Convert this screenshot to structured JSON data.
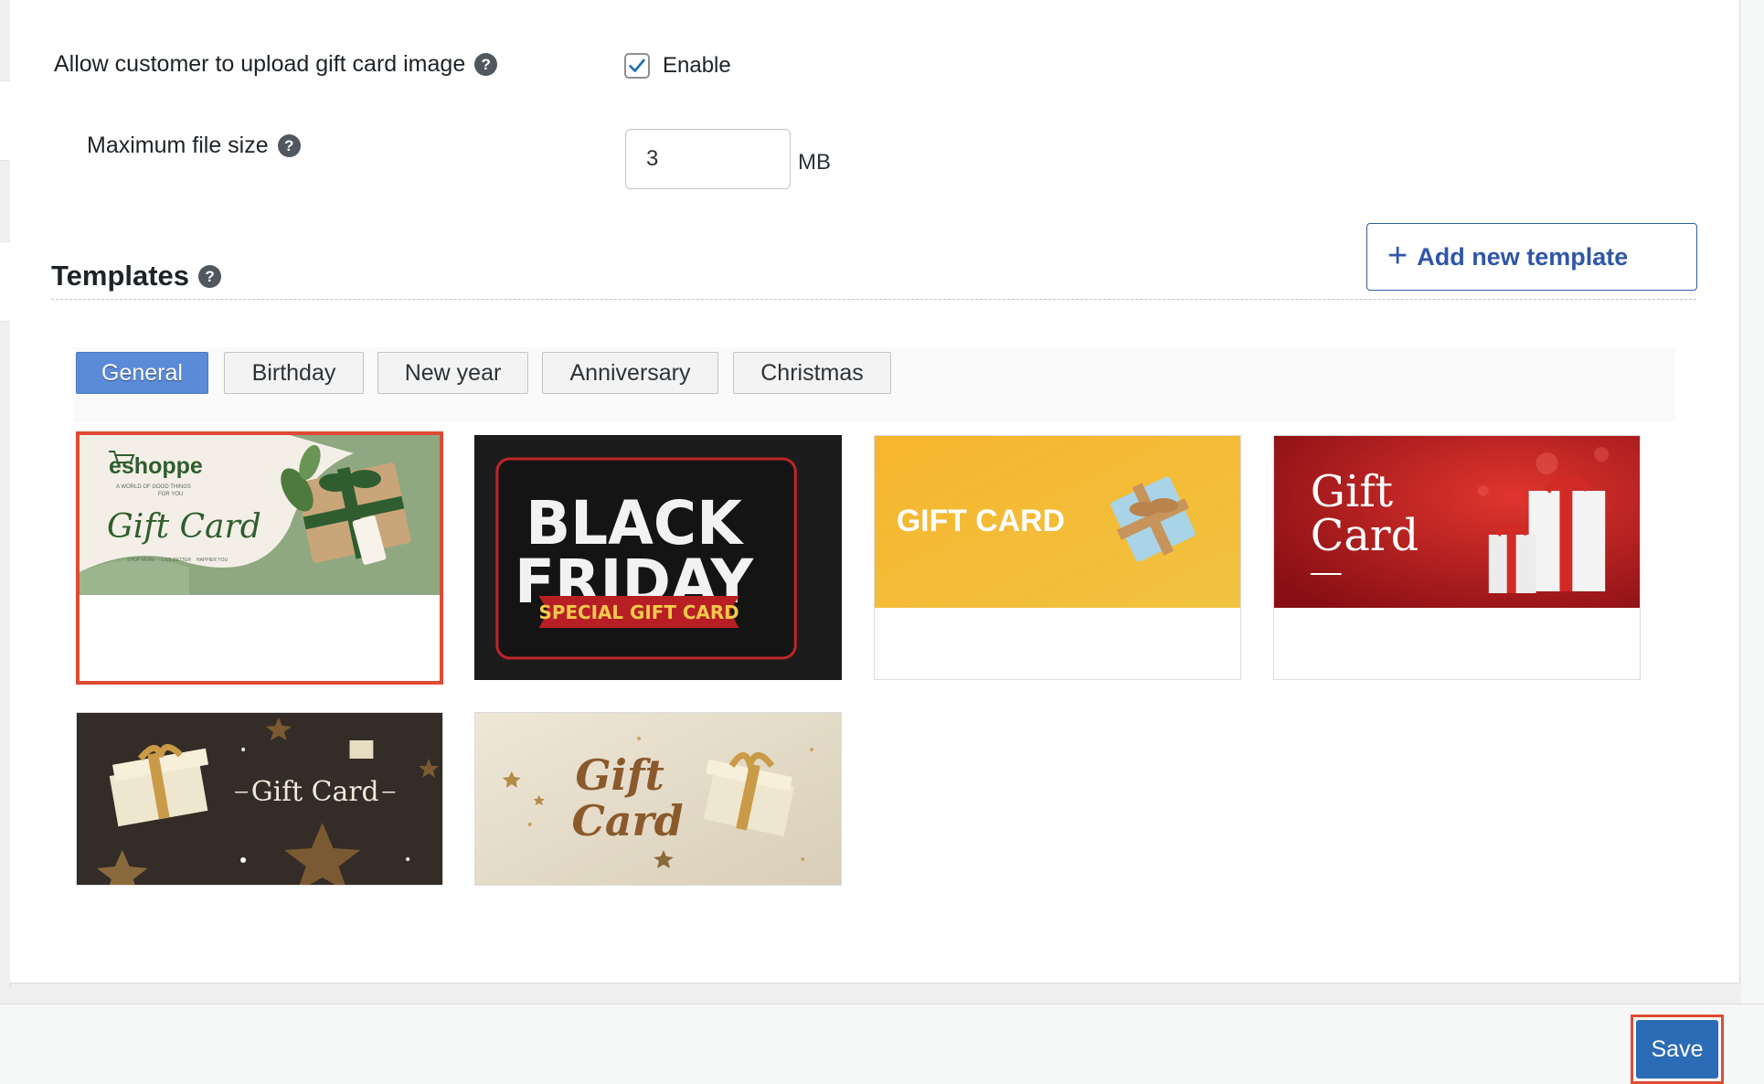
{
  "upload_setting": {
    "label": "Allow customer to upload gift card image",
    "help": "?",
    "enabled": true,
    "checkbox_label": "Enable"
  },
  "max_file_size": {
    "label": "Maximum file size",
    "help": "?",
    "value": "3",
    "unit": "MB"
  },
  "templates": {
    "title": "Templates",
    "help": "?",
    "add_button_icon": "plus-icon",
    "add_button_label": "Add new template",
    "tabs": [
      {
        "label": "General",
        "active": true
      },
      {
        "label": "Birthday",
        "active": false
      },
      {
        "label": "New year",
        "active": false
      },
      {
        "label": "Anniversary",
        "active": false
      },
      {
        "label": "Christmas",
        "active": false
      }
    ],
    "cards": [
      {
        "text_lines": [
          "eshoppe",
          "A WORLD OF GOOD THINGS",
          "FOR YOU",
          "Gift Card",
          "SHOP MORE",
          "LIVE BETTER",
          "HAPPIER YOU"
        ],
        "selected": true
      },
      {
        "text_lines": [
          "BLACK",
          "FRIDAY",
          "SPECIAL GIFT CARD"
        ],
        "selected": false
      },
      {
        "text_lines": [
          "GIFT CARD"
        ],
        "selected": false
      },
      {
        "text_lines": [
          "Gift",
          "Card"
        ],
        "selected": false
      },
      {
        "text_lines": [
          "Gift Card"
        ],
        "selected": false
      },
      {
        "text_lines": [
          "Gift",
          "Card"
        ],
        "selected": false
      }
    ]
  },
  "footer": {
    "save_label": "Save"
  },
  "colors": {
    "accent": "#2c6bb5",
    "tab_active": "#5b8ad6",
    "selected_outline": "#e04a33"
  }
}
